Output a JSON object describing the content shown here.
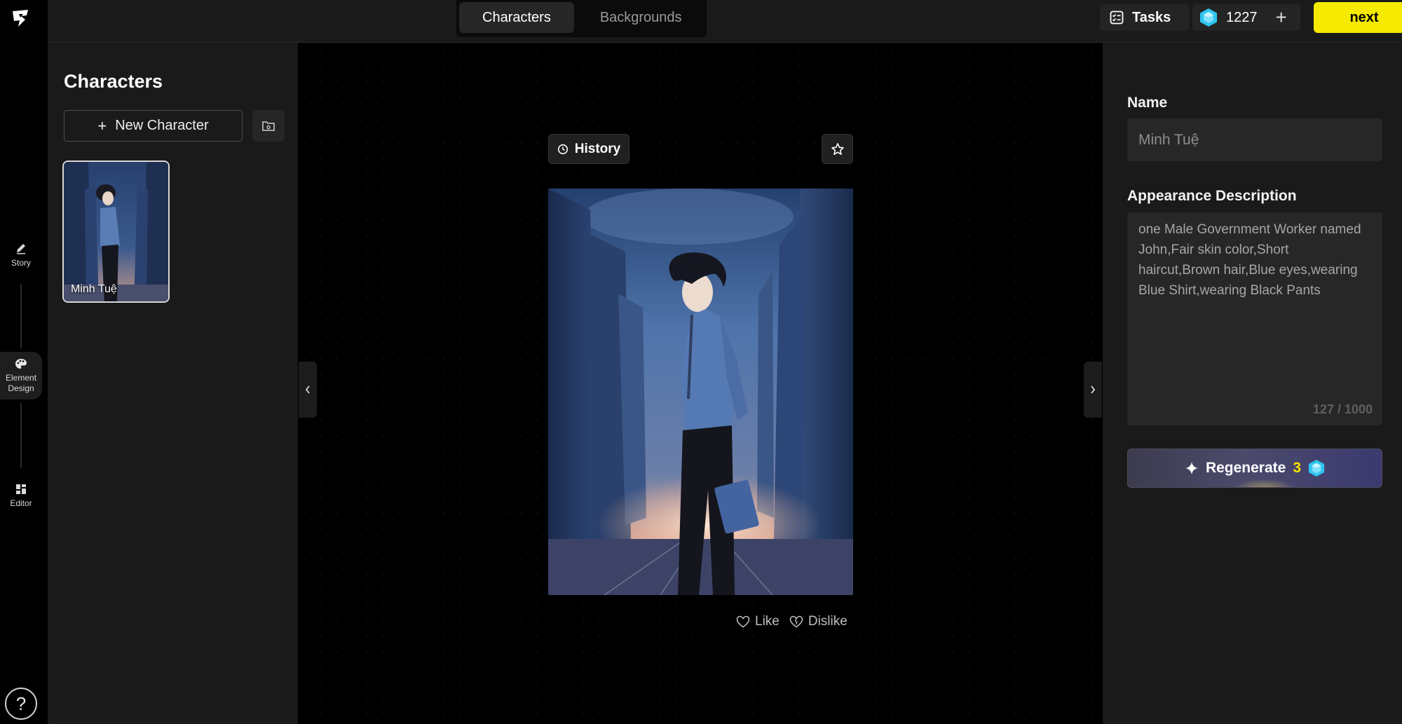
{
  "rail": {
    "items": [
      {
        "label": "Story",
        "icon": "pencil-icon"
      },
      {
        "label": "Element Design",
        "icon": "palette-icon"
      },
      {
        "label": "Editor",
        "icon": "layout-icon"
      }
    ],
    "help": "?"
  },
  "topbar": {
    "tabs": [
      {
        "label": "Characters",
        "active": true
      },
      {
        "label": "Backgrounds",
        "active": false
      }
    ],
    "tasks_label": "Tasks",
    "credits": "1227",
    "next_label": "next"
  },
  "characters_panel": {
    "title": "Characters",
    "new_character_label": "New Character",
    "items": [
      {
        "name": "Minh Tuệ"
      }
    ]
  },
  "canvas": {
    "history_label": "History",
    "like_label": "Like",
    "dislike_label": "Dislike"
  },
  "details": {
    "name_label": "Name",
    "name_value": "Minh Tuệ",
    "appearance_label": "Appearance Description",
    "appearance_value": "one Male Government Worker named John,Fair skin color,Short haircut,Brown hair,Blue eyes,wearing Blue Shirt,wearing Black Pants",
    "char_count": "127 / 1000",
    "regenerate_label": "Regenerate",
    "regenerate_cost": "3"
  },
  "colors": {
    "accent_yellow": "#f5ea00",
    "gem_blue": "#2ec4f0",
    "panel_bg": "#1a1a1a"
  }
}
